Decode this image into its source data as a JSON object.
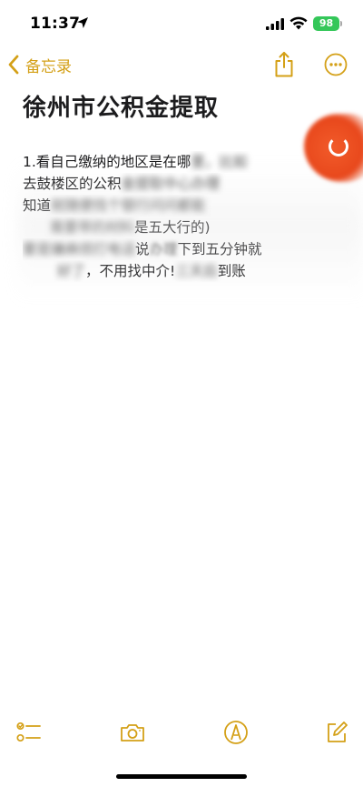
{
  "status_bar": {
    "time": "11:37",
    "battery": "98"
  },
  "nav": {
    "back_label": "备忘录"
  },
  "note": {
    "title": "徐州市公积金提取",
    "lines": [
      {
        "text": "1.看自己缴纳的地区是在哪",
        "blurred": "里，比如"
      },
      {
        "text": "去鼓楼区的公积",
        "blurred": "金提取中心办理"
      },
      {
        "text": "知道",
        "blurred": "就随便找个银行问问都能"
      },
      {
        "text": "",
        "blurred": "需要带的材料",
        "text_after": "是五大行的)"
      },
      {
        "text": "",
        "blurred": "要是嫌麻烦打电话",
        "text_after": "说",
        "blurred2": "办理",
        "text_after2": "下到五分钟就"
      },
      {
        "text": "",
        "blurred": "好了",
        "text_after": "，不用找中介!",
        "blurred2": "三天后",
        "text_after2": "到账"
      }
    ]
  },
  "icons": {
    "location": "location-arrow-icon",
    "signal": "cellular-signal-icon",
    "wifi": "wifi-icon",
    "back": "chevron-left-icon",
    "share": "share-icon",
    "more": "ellipsis-circle-icon",
    "checklist": "checklist-icon",
    "camera": "camera-icon",
    "markup": "markup-pen-icon",
    "compose": "compose-icon"
  },
  "colors": {
    "accent": "#d4a017",
    "battery": "#34c759",
    "text": "#1c1c1e"
  }
}
